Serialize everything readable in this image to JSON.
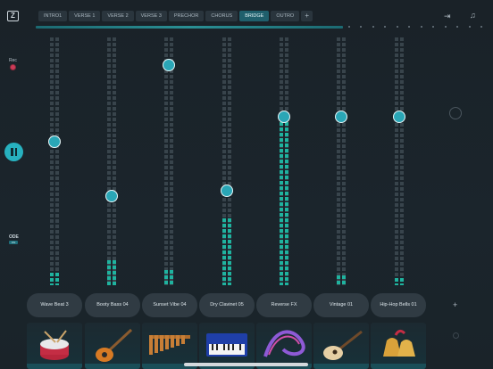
{
  "toolbar": {
    "sections": [
      "INTRO1",
      "VERSE 1",
      "VERSE 2",
      "VERSE 3",
      "PRECHOR",
      "CHORUS",
      "BRIDGE",
      "OUTRO"
    ],
    "active_section": "BRIDGE",
    "add_label": "+",
    "logo": "Z",
    "icons": [
      "logo-icon",
      "collapse-arrow-icon",
      "score-icon"
    ]
  },
  "left_panel": {
    "rec_label": "Rec",
    "mode_label": "ODE",
    "mode_badge": "ON"
  },
  "tracks": [
    {
      "name": "Wave Beat 3",
      "instrument": "drum-icon",
      "level": 0.58,
      "meter": 0.05
    },
    {
      "name": "Booty Bass 04",
      "instrument": "electric-guitar-icon",
      "level": 0.36,
      "meter": 0.1
    },
    {
      "name": "Sunset Vibe 04",
      "instrument": "marimba-icon",
      "level": 0.89,
      "meter": 0.06
    },
    {
      "name": "Dry Clavinet 05",
      "instrument": "keyboard-icon",
      "level": 0.38,
      "meter": 0.27
    },
    {
      "name": "Reverse FX",
      "instrument": "abstract-wave-icon",
      "level": 0.68,
      "meter": 0.68
    },
    {
      "name": "Vintage 01",
      "instrument": "acoustic-guitar-icon",
      "level": 0.68,
      "meter": 0.04
    },
    {
      "name": "Hip-Hop Bells 01",
      "instrument": "bells-icon",
      "level": 0.68,
      "meter": 0.03
    }
  ],
  "track_add_label": "+",
  "colors": {
    "accent": "#27b1bf",
    "meter_active": "#1fb39f",
    "rec": "#cc3b57",
    "tab_active": "#1f5f6c"
  }
}
